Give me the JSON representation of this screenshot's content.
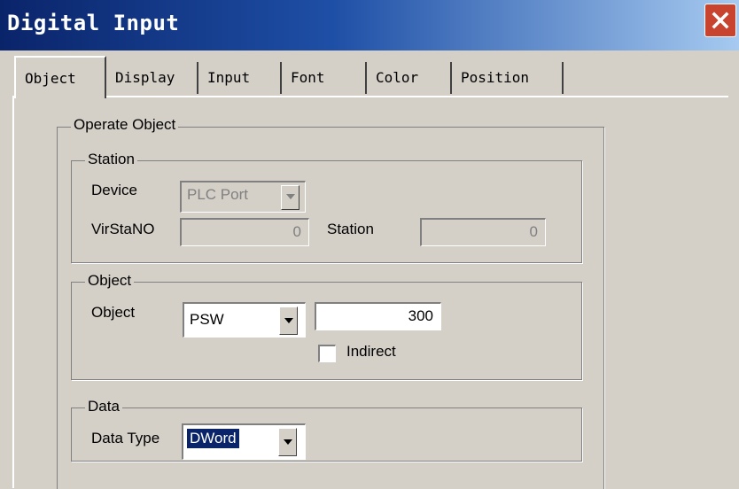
{
  "window": {
    "title": "Digital Input"
  },
  "tabs": [
    "Object",
    "Display",
    "Input",
    "Font",
    "Color",
    "Position"
  ],
  "operate_object": {
    "label": "Operate Object",
    "station": {
      "label": "Station",
      "device_label": "Device",
      "device_value": "PLC Port",
      "virstano_label": "VirStaNO",
      "virstano_value": "0",
      "station_label": "Station",
      "station_value": "0"
    },
    "object": {
      "label": "Object",
      "object_label": "Object",
      "object_type": "PSW",
      "object_address": "300",
      "indirect_label": "Indirect",
      "indirect_checked": false
    },
    "data": {
      "label": "Data",
      "data_type_label": "Data Type",
      "data_type_value": "DWord"
    }
  },
  "colors": {
    "title_bar": "#0a246a",
    "close_button": "#c8442f",
    "face": "#d4d0c8",
    "selection": "#0a246a"
  }
}
